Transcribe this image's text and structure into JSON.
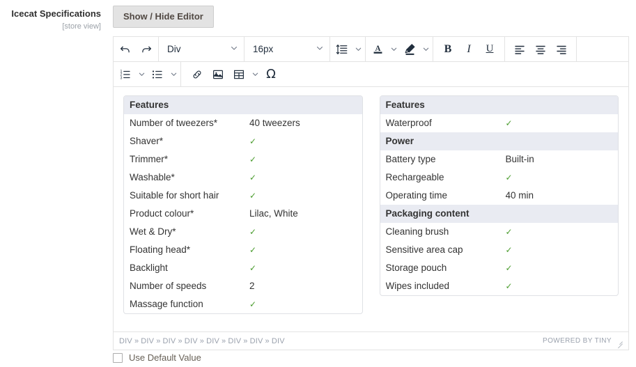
{
  "field": {
    "label": "Icecat Specifications",
    "scope": "[store view]"
  },
  "toolbar_button": {
    "show_hide_editor": "Show / Hide Editor"
  },
  "editor": {
    "toolbar_row1": {
      "undo": "undo-icon",
      "redo": "redo-icon",
      "format_select": "Div",
      "fontsize_select": "16px",
      "lineheight": "line-height-icon",
      "forecolor": "text-color-icon",
      "backcolor": "highlight-color-icon",
      "bold": "B",
      "italic": "I",
      "underline": "U",
      "align_left": "align-left-icon",
      "align_center": "align-center-icon",
      "align_right": "align-right-icon"
    },
    "toolbar_row2": {
      "numlist": "numbered-list-icon",
      "bullist": "bullet-list-icon",
      "link": "link-icon",
      "image": "image-icon",
      "table": "table-icon",
      "charmap": "Ω"
    },
    "status": {
      "path": [
        "DIV",
        "DIV",
        "DIV",
        "DIV",
        "DIV",
        "DIV",
        "DIV",
        "DIV"
      ],
      "separator": "»",
      "brand": "POWERED BY TINY"
    }
  },
  "content": {
    "left_block": {
      "header": "Features",
      "rows": [
        {
          "name": "Number of tweezers*",
          "value": "40 tweezers",
          "check": false
        },
        {
          "name": "Shaver*",
          "value": "✓",
          "check": true
        },
        {
          "name": "Trimmer*",
          "value": "✓",
          "check": true
        },
        {
          "name": "Washable*",
          "value": "✓",
          "check": true
        },
        {
          "name": "Suitable for short hair",
          "value": "✓",
          "check": true
        },
        {
          "name": "Product colour*",
          "value": "Lilac, White",
          "check": false
        },
        {
          "name": "Wet & Dry*",
          "value": "✓",
          "check": true
        },
        {
          "name": "Floating head*",
          "value": "✓",
          "check": true
        },
        {
          "name": "Backlight",
          "value": "✓",
          "check": true
        },
        {
          "name": "Number of speeds",
          "value": "2",
          "check": false
        },
        {
          "name": "Massage function",
          "value": "✓",
          "check": true
        }
      ]
    },
    "right_block": {
      "sections": [
        {
          "header": "Features",
          "rows": [
            {
              "name": "Waterproof",
              "value": "✓",
              "check": true
            }
          ]
        },
        {
          "header": "Power",
          "rows": [
            {
              "name": "Battery type",
              "value": "Built-in",
              "check": false
            },
            {
              "name": "Rechargeable",
              "value": "✓",
              "check": true
            },
            {
              "name": "Operating time",
              "value": "40 min",
              "check": false
            }
          ]
        },
        {
          "header": "Packaging content",
          "rows": [
            {
              "name": "Cleaning brush",
              "value": "✓",
              "check": true
            },
            {
              "name": "Sensitive area cap",
              "value": "✓",
              "check": true
            },
            {
              "name": "Storage pouch",
              "value": "✓",
              "check": true
            },
            {
              "name": "Wipes included",
              "value": "✓",
              "check": true
            }
          ]
        }
      ]
    }
  },
  "use_default": {
    "label": "Use Default Value",
    "checked": false
  },
  "colors": {
    "header_bg": "#e9ebf2",
    "check_green": "#4a9c2d",
    "border": "#dfe1e5",
    "toolbar_icon": "#222f3e",
    "muted_text": "#9aa1ad"
  }
}
